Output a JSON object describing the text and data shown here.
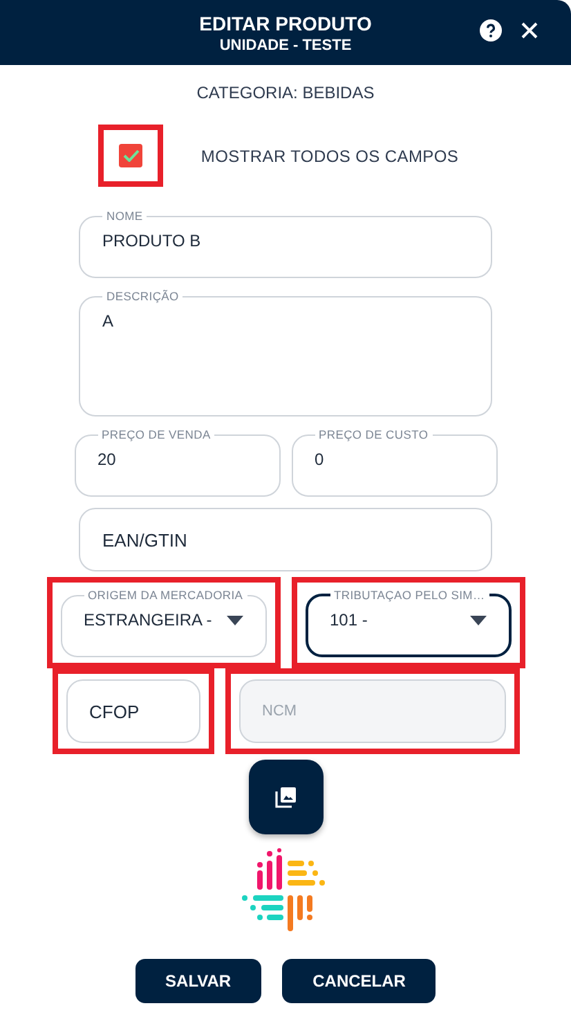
{
  "header": {
    "title": "EDITAR PRODUTO",
    "subtitle": "UNIDADE - TESTE"
  },
  "category": "CATEGORIA: BEBIDAS",
  "show_all": {
    "label": "MOSTRAR TODOS OS CAMPOS",
    "checked": true,
    "highlighted": true
  },
  "fields": [
    {
      "kind": "text",
      "label": "NOME",
      "value": "PRODUTO B",
      "highlighted": false
    },
    {
      "kind": "textarea",
      "label": "DESCRIÇÃO",
      "value": "A",
      "highlighted": false
    },
    {
      "kind": "pair",
      "items": [
        {
          "kind": "text",
          "label": "PREÇO DE VENDA",
          "value": "20",
          "highlighted": false
        },
        {
          "kind": "text",
          "label": "PREÇO DE CUSTO",
          "value": "0",
          "highlighted": false
        }
      ]
    },
    {
      "kind": "text",
      "placeholder": "EAN/GTIN",
      "highlighted": false
    },
    {
      "kind": "pair",
      "items": [
        {
          "kind": "select",
          "label": "ORIGEM DA MERCADORIA",
          "value": "ESTRANGEIRA -",
          "focused": false,
          "highlighted": true
        },
        {
          "kind": "select",
          "label": "TRIBUTAÇAO PELO SIM…",
          "value": "101 -",
          "focused": true,
          "highlighted": true
        }
      ]
    },
    {
      "kind": "pair",
      "items": [
        {
          "kind": "text",
          "placeholder": "CFOP",
          "disabled": false,
          "highlighted": true
        },
        {
          "kind": "text",
          "placeholder": "NCM",
          "disabled": true,
          "highlighted": true
        }
      ]
    }
  ],
  "buttons": [
    {
      "label": "SALVAR"
    },
    {
      "label": "CANCELAR"
    }
  ]
}
